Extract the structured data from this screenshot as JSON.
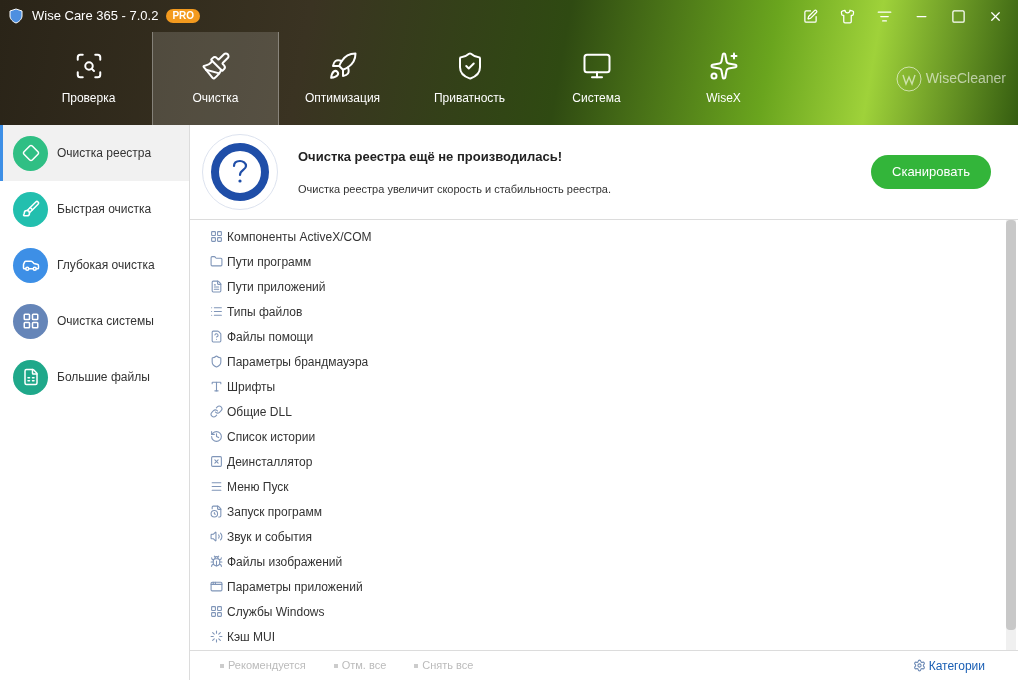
{
  "window": {
    "title": "Wise Care 365 - 7.0.2",
    "badge": "PRO"
  },
  "nav_tabs": [
    {
      "label": "Проверка",
      "selected": false
    },
    {
      "label": "Очистка",
      "selected": true
    },
    {
      "label": "Оптимизация",
      "selected": false
    },
    {
      "label": "Приватность",
      "selected": false
    },
    {
      "label": "Система",
      "selected": false
    },
    {
      "label": "WiseX",
      "selected": false
    }
  ],
  "brand": "WiseCleaner",
  "sidebar": {
    "items": [
      {
        "label": "Очистка реестра",
        "selected": true,
        "color": "#2fbf84"
      },
      {
        "label": "Быстрая очистка",
        "selected": false,
        "color": "#22bfae"
      },
      {
        "label": "Глубокая очистка",
        "selected": false,
        "color": "#3d8fe6"
      },
      {
        "label": "Очистка системы",
        "selected": false,
        "color": "#6585b8"
      },
      {
        "label": "Большие файлы",
        "selected": false,
        "color": "#1fa88a"
      }
    ]
  },
  "status": {
    "title": "Очистка реестра ещё не производилась!",
    "description": "Очистка реестра увеличит скорость и стабильность реестра.",
    "scan_button": "Сканировать"
  },
  "categories": [
    "Компоненты ActiveX/COM",
    "Пути программ",
    "Пути приложений",
    "Типы файлов",
    "Файлы помощи",
    "Параметры брандмауэра",
    "Шрифты",
    "Общие DLL",
    "Список истории",
    "Деинсталлятор",
    "Меню Пуск",
    "Запуск программ",
    "Звук и события",
    "Файлы изображений",
    "Параметры приложений",
    "Службы Windows",
    "Кэш MUI"
  ],
  "footer": {
    "actions": [
      {
        "label": "Рекомендуется",
        "disabled": true
      },
      {
        "label": "Отм. все",
        "disabled": true
      },
      {
        "label": "Снять все",
        "disabled": true
      }
    ],
    "categories_link": "Категории"
  }
}
